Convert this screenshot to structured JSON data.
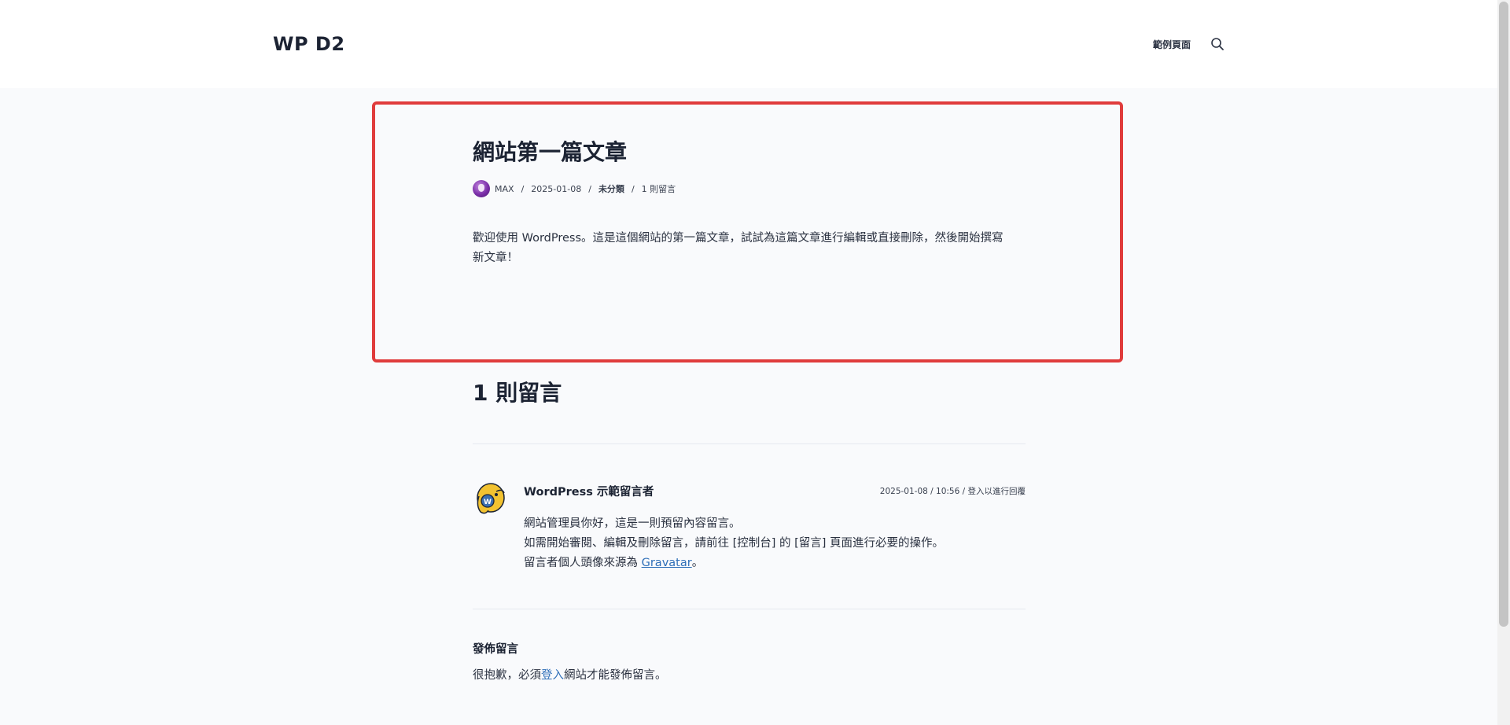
{
  "header": {
    "site_title": "WP D2",
    "nav_item": "範例頁面",
    "search_icon": "search-icon"
  },
  "post": {
    "title": "網站第一篇文章",
    "author": "MAX",
    "sep": "/",
    "date": "2025-01-08",
    "category": "未分類",
    "comments_count": "1 則留言",
    "content_line1": "歡迎使用 WordPress。這是這個網站的第一篇文章，試試為這篇文章進行編輯或直接刪除，然後開始撰寫",
    "content_line2": "新文章！"
  },
  "comments": {
    "title": "1 則留言",
    "items": [
      {
        "author": "WordPress 示範留言者",
        "datetime": "2025-01-08 / 10:56",
        "meta_sep": " / ",
        "reply_link": "登入以進行回覆",
        "line1": "網站管理員你好，這是一則預留內容留言。",
        "line2": "如需開始審閱、編輯及刪除留言，請前往 [控制台] 的 [留言] 頁面進行必要的操作。",
        "line3_prefix": "留言者個人頭像來源為 ",
        "line3_link": "Gravatar",
        "line3_suffix": "。"
      }
    ]
  },
  "reply": {
    "title": "發佈留言",
    "note_prefix": "很抱歉，必須",
    "note_link": "登入",
    "note_suffix": "網站才能發佈留言。"
  },
  "colors": {
    "highlight": "#e03c3c",
    "link": "#2f6fb8"
  }
}
